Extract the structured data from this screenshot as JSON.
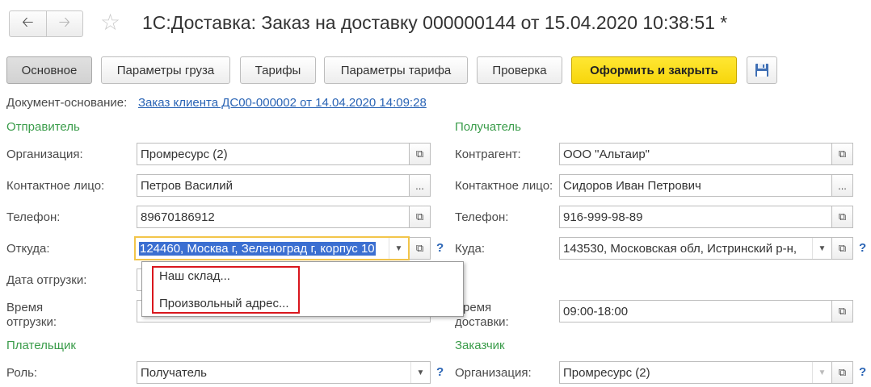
{
  "nav": {
    "back_icon": "arrow-left-icon",
    "forward_icon": "arrow-right-icon",
    "favorite_icon": "star-icon"
  },
  "window": {
    "title": "1С:Доставка: Заказ на доставку 000000144 от 15.04.2020 10:38:51 *"
  },
  "toolbar": {
    "tab_main": "Основное",
    "tab_cargo": "Параметры груза",
    "tab_tariffs": "Тарифы",
    "tab_tariff_params": "Параметры тарифа",
    "tab_check": "Проверка",
    "submit_label": "Оформить и закрыть",
    "save_icon": "floppy-disk-icon"
  },
  "document_basis": {
    "label": "Документ-основание:",
    "link": "Заказ клиента ДС00-000002 от 14.04.2020 14:09:28"
  },
  "sender": {
    "section": "Отправитель",
    "organization_label": "Организация:",
    "organization_value": "Промресурс (2)",
    "contact_label": "Контактное лицо:",
    "contact_value": "Петров Василий",
    "phone_label": "Телефон:",
    "phone_value": "89670186912",
    "from_label": "Откуда:",
    "from_value": "124460, Москва г, Зеленоград г, корпус 10",
    "ship_date_label": "Дата отгрузки:",
    "ship_time_label_1": "Время",
    "ship_time_label_2": "отгрузки:"
  },
  "receiver": {
    "section": "Получатель",
    "counterparty_label": "Контрагент:",
    "counterparty_value": "ООО \"Альтаир\"",
    "contact_label": "Контактное лицо:",
    "contact_value": "Сидоров Иван Петрович",
    "phone_label": "Телефон:",
    "phone_value": "916-999-98-89",
    "to_label": "Куда:",
    "to_value": "143530, Московская обл, Истринский р-н,",
    "delivery_time_label_1": "Время",
    "delivery_time_label_2": "доставки:",
    "delivery_time_value": "09:00-18:00"
  },
  "payer": {
    "section": "Плательщик",
    "role_label": "Роль:",
    "role_value": "Получатель"
  },
  "customer": {
    "section": "Заказчик",
    "organization_label": "Организация:",
    "organization_value": "Промресурс (2)"
  },
  "dropdown": {
    "items": [
      "Наш склад...",
      "Произвольный адрес..."
    ]
  },
  "help_mark": "?",
  "ellipsis": "..."
}
